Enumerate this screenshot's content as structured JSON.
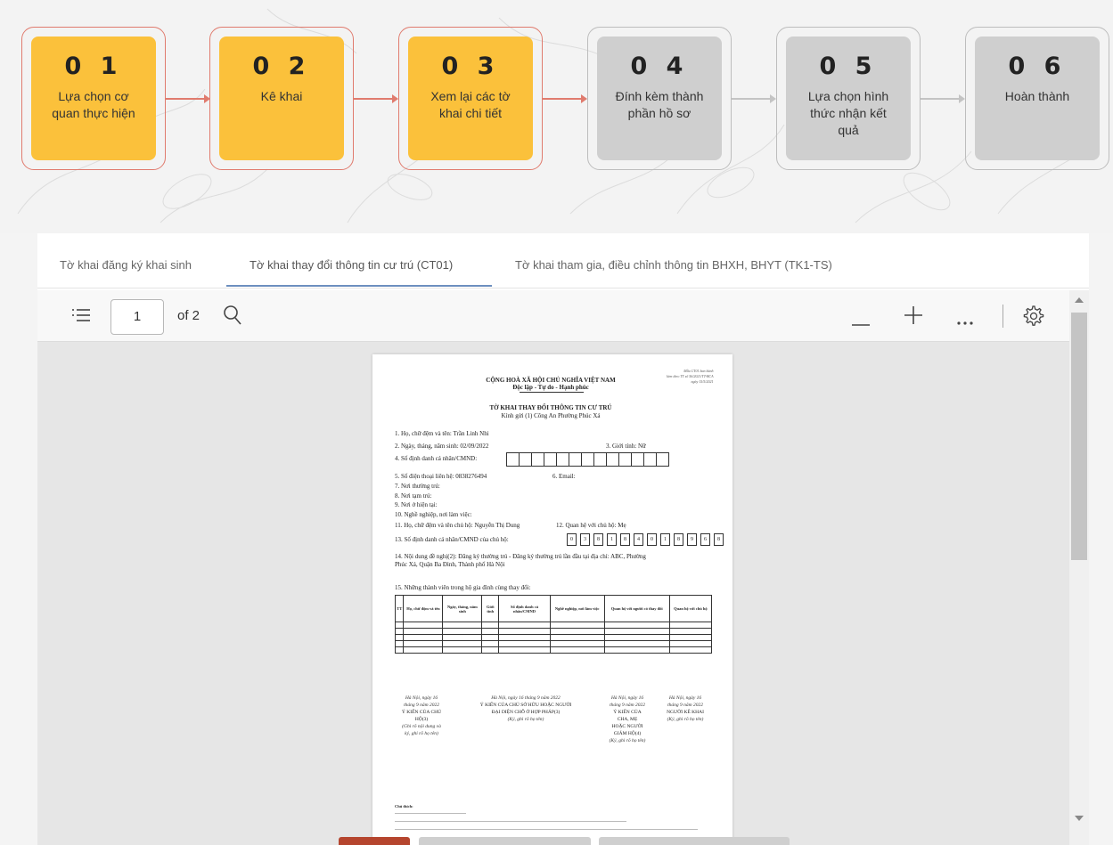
{
  "steps": [
    {
      "num": "0 1",
      "label": "Lựa chọn cơ quan thực hiện",
      "state": "done"
    },
    {
      "num": "0 2",
      "label": "Kê khai",
      "state": "done"
    },
    {
      "num": "0 3",
      "label": "Xem lại các tờ khai chi tiết",
      "state": "current"
    },
    {
      "num": "0 4",
      "label": "Đính kèm thành phần hồ sơ",
      "state": "pending"
    },
    {
      "num": "0 5",
      "label": "Lựa chọn hình thức nhận kết quả",
      "state": "pending"
    },
    {
      "num": "0 6",
      "label": "Hoàn thành",
      "state": "pending"
    }
  ],
  "colors": {
    "active": "#fbc13b",
    "active_border": "#e07b6e",
    "pending": "#cfcfcf",
    "tab_underline": "#6d8fbf"
  },
  "tabs": [
    {
      "label": "Tờ khai đăng ký khai sinh"
    },
    {
      "label": "Tờ khai thay đổi thông tin cư trú (CT01)",
      "active": true
    },
    {
      "label": "Tờ khai tham gia, điều chỉnh thông tin BHXH, BHYT (TK1-TS)"
    }
  ],
  "viewer": {
    "page_current": "1",
    "page_total_label": "of 2",
    "icons": [
      "contents-icon",
      "search-icon",
      "zoom-out-icon",
      "zoom-in-icon",
      "more-icon",
      "settings-icon"
    ]
  },
  "doc": {
    "form_note": "Mẫu CT01 ban hành\nkèm theo TT số 56/2021/TT-BCA\nngày 15/5/2021",
    "nation": "CỘNG HOÀ XÃ HỘI CHỦ NGHĨA VIỆT NAM",
    "motto": "Độc lập - Tự do - Hạnh phúc",
    "title": "TỜ KHAI THAY ĐỔI THÔNG TIN CƯ TRÚ",
    "recipient": "Kính gửi (1) Công An Phường Phúc Xá",
    "f1": "1. Họ, chữ đệm và tên: Trần Linh Nhi",
    "f2": "2. Ngày, tháng, năm sinh: 02/09/2022",
    "f3": "3. Giới tính: Nữ",
    "f4": "4. Số định danh cá nhân/CMND:",
    "f5": "5. Số điện thoại liên hệ: 0838276494",
    "f6": "6. Email:",
    "f7": "7. Nơi thường trú:",
    "f8": "8. Nơi tạm trú:",
    "f9": "9. Nơi ở hiện tại:",
    "f10": "10. Nghề nghiệp, nơi làm việc:",
    "f11": "11. Họ, chữ đệm và tên chủ hộ: Nguyễn Thị Dung",
    "f12": "12. Quan hệ với chủ hộ: Mẹ",
    "f13": "13. Số định danh cá nhân/CMND của chủ hộ:",
    "f13_digits": [
      "0",
      "3",
      "8",
      "1",
      "8",
      "4",
      "0",
      "1",
      "8",
      "9",
      "6",
      "8"
    ],
    "f14_line1": "14. Nội dung đề nghị(2): Đăng ký thường trú - Đăng ký thường trú lần đầu tại địa chỉ: ABC, Phường",
    "f14_line2": "Phúc Xá, Quận Ba Đình, Thành phố Hà Nội",
    "f15": "15. Những thành viên trong hộ gia đình cùng thay đổi:",
    "table_headers": [
      "TT",
      "Họ, chữ đệm và tên",
      "Ngày, tháng, năm sinh",
      "Giới tính",
      "Số định danh cá nhân/CMND",
      "Nghề nghiệp, nơi làm việc",
      "Quan hệ với người có thay đổi",
      "Quan hệ với chủ hộ"
    ],
    "sig1_date": "Hà Nội, ngày 16\ntháng 9 năm 2022",
    "sig1_title": "Ý KIẾN CỦA CHỦ\nHỘ(3)",
    "sig1_note": "(Ghi rõ nội dung và\nký, ghi rõ họ tên)",
    "sig2_date": "Hà Nội, ngày 16 tháng 9 năm 2022",
    "sig2_title": "Ý KIẾN CỦA CHỦ SỞ HỮU HOẶC NGƯỜI\nĐẠI DIỆN CHỖ Ở HỢP PHÁP(3)",
    "sig2_note": "(Ký, ghi rõ họ tên)",
    "sig3_date": "Hà Nội, ngày 16\ntháng 9 năm 2022",
    "sig3_title": "Ý KIẾN CỦA\nCHA, MẸ\nHOẶC NGƯỜI\nGIÁM HỘ(4)",
    "sig3_note": "(Ký, ghi rõ họ tên)",
    "sig4_date": "Hà Nội, ngày 16\ntháng 9 năm 2022",
    "sig4_title": "NGƯỜI KÊ KHAI",
    "sig4_note": "(Ký, ghi rõ họ tên)",
    "footnote_title": "Chú thích:"
  }
}
